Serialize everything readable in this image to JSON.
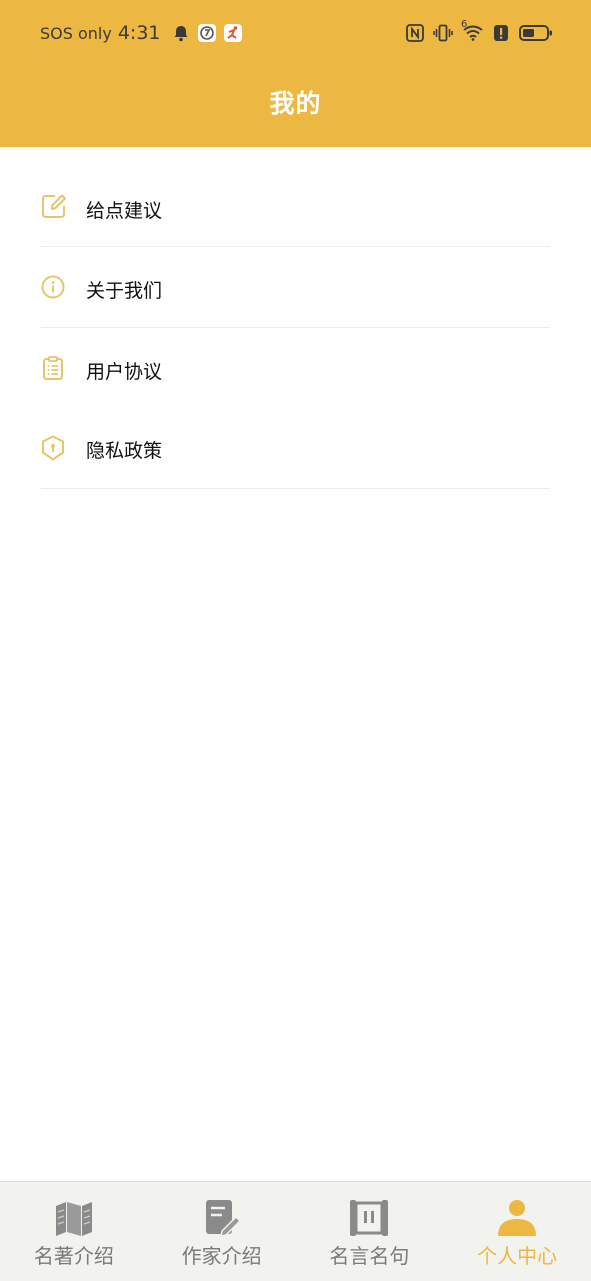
{
  "status_bar": {
    "carrier": "SOS only",
    "time": "4:31",
    "network_label": "6"
  },
  "header": {
    "title": "我的"
  },
  "menu": {
    "items": [
      {
        "label": "给点建议",
        "icon": "edit-icon"
      },
      {
        "label": "关于我们",
        "icon": "info-icon"
      },
      {
        "label": "用户协议",
        "icon": "clipboard-icon"
      },
      {
        "label": "隐私政策",
        "icon": "shield-icon"
      }
    ]
  },
  "tabbar": {
    "tabs": [
      {
        "label": "名著介绍",
        "icon": "book-icon",
        "active": false
      },
      {
        "label": "作家介绍",
        "icon": "writer-icon",
        "active": false
      },
      {
        "label": "名言名句",
        "icon": "scroll-icon",
        "active": false
      },
      {
        "label": "个人中心",
        "icon": "person-icon",
        "active": true
      }
    ]
  },
  "colors": {
    "accent": "#ECB841",
    "icon_outline": "#E8C46A",
    "tab_inactive": "#7a7a7a",
    "tab_bar_bg": "#F2F2EE"
  }
}
